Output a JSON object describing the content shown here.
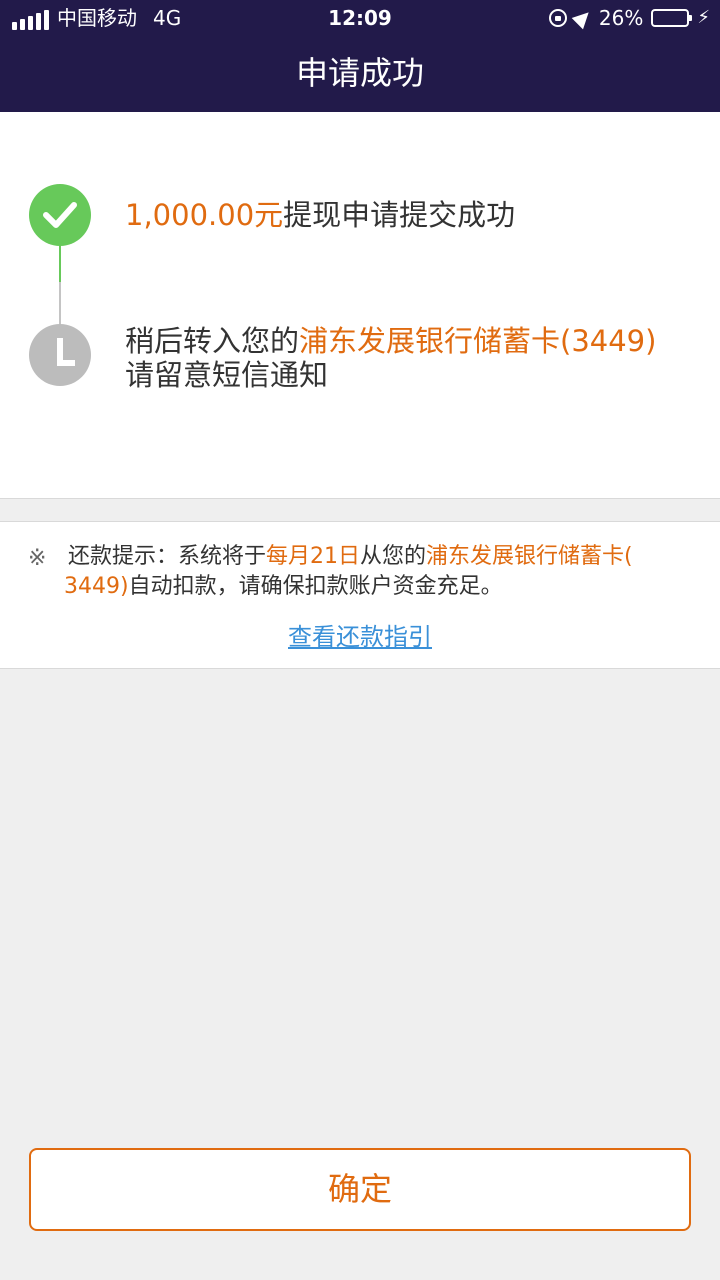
{
  "status_bar": {
    "carrier": "中国移动",
    "network": "4G",
    "time": "12:09",
    "battery": "26%",
    "battery_level": 0.26,
    "icons": [
      "signal-icon",
      "orientation-lock-icon",
      "location-icon",
      "battery-icon",
      "charging-icon"
    ]
  },
  "nav": {
    "title": "申请成功"
  },
  "steps": [
    {
      "amount": "1,000.00元",
      "text": "提现申请提交成功",
      "icon": "check-icon",
      "color": "#67c95a"
    },
    {
      "text_prefix": "稍后转入您的",
      "bank": "浦东发展银行储蓄卡(3449)",
      "text_line2": "请留意短信通知",
      "icon": "clock-icon",
      "color": "#bcbcbc"
    }
  ],
  "tip": {
    "mark": "※",
    "label": "还款提示：系统将于",
    "date": "每月21日",
    "from": "从您的",
    "bank_part1": "浦东发展银行储蓄卡(",
    "bank_part2": "3449)",
    "rest": "自动扣款，请确保扣款账户资金充足。",
    "link": "查看还款指引"
  },
  "button": {
    "label": "确定"
  },
  "colors": {
    "header_bg": "#221a4a",
    "accent": "#e06b10",
    "success": "#67c95a",
    "link": "#3a90d8"
  }
}
